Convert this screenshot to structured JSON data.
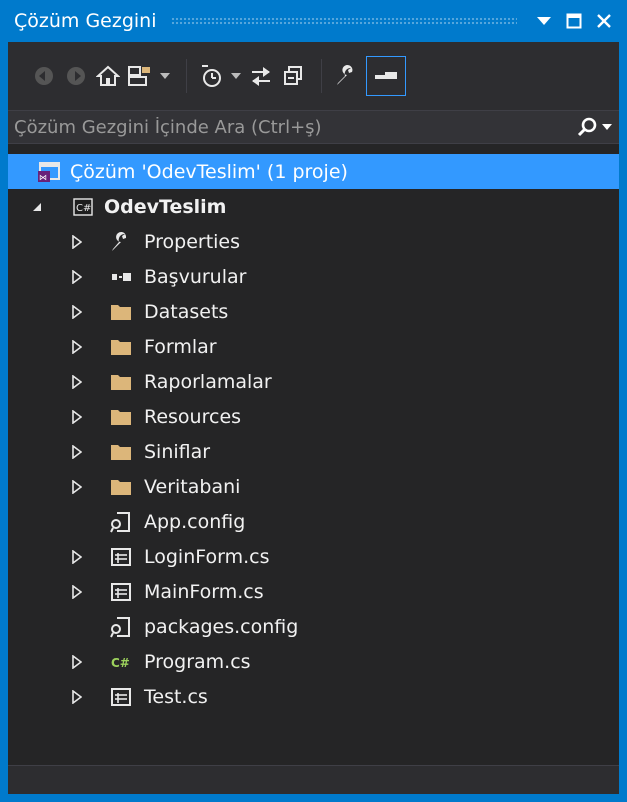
{
  "window": {
    "title": "Çözüm Gezgini"
  },
  "search": {
    "placeholder": "Çözüm Gezgini İçinde Ara (Ctrl+ş)"
  },
  "colors": {
    "accent": "#007acc",
    "selection": "#3399ff",
    "background": "#252526",
    "text": "#f1f1f1",
    "folder": "#dcb67a"
  },
  "tree": {
    "solution": "Çözüm 'OdevTeslim' (1 proje)",
    "project": "OdevTeslim",
    "items": [
      {
        "label": "Properties",
        "icon": "wrench-icon"
      },
      {
        "label": "Başvurular",
        "icon": "references-icon"
      },
      {
        "label": "Datasets",
        "icon": "folder-icon"
      },
      {
        "label": "Formlar",
        "icon": "folder-icon"
      },
      {
        "label": "Raporlamalar",
        "icon": "folder-icon"
      },
      {
        "label": "Resources",
        "icon": "folder-icon"
      },
      {
        "label": "Siniflar",
        "icon": "folder-icon"
      },
      {
        "label": "Veritabani",
        "icon": "folder-icon"
      },
      {
        "label": "App.config",
        "icon": "config-file-icon"
      },
      {
        "label": "LoginForm.cs",
        "icon": "form-icon"
      },
      {
        "label": "MainForm.cs",
        "icon": "form-icon"
      },
      {
        "label": "packages.config",
        "icon": "config-file-icon"
      },
      {
        "label": "Program.cs",
        "icon": "csharp-file-icon"
      },
      {
        "label": "Test.cs",
        "icon": "form-icon"
      }
    ]
  }
}
